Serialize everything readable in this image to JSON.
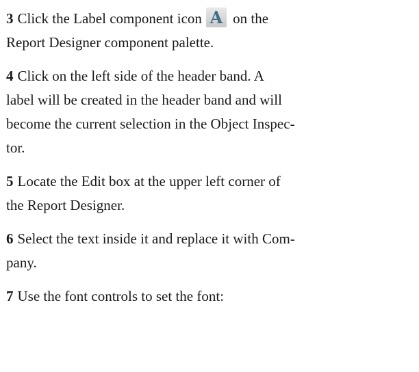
{
  "steps": [
    {
      "number": "3",
      "text_before_icon": "Click the Label component icon",
      "icon": "label-component-icon",
      "icon_glyph": "A",
      "text_after_icon": "on the",
      "line2": "Report Designer component palette."
    },
    {
      "number": "4",
      "line1": "Click on the left side of the header band.  A",
      "line2": "label will be created in the header band and will",
      "line3": "become the current selection in the Object Inspec-",
      "line4": "tor."
    },
    {
      "number": "5",
      "line1": "Locate the Edit box at the upper left corner of",
      "line2": "the Report Designer."
    },
    {
      "number": "6",
      "line1": "Select the text inside it and replace it with Com-",
      "line2": "pany."
    },
    {
      "number": "7",
      "line1": "Use the font controls to set the font:"
    }
  ]
}
